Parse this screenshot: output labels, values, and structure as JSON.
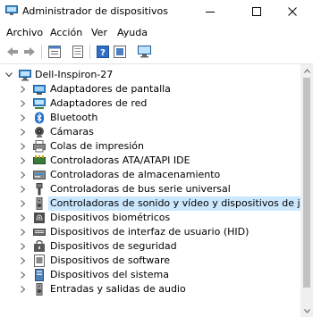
{
  "window": {
    "title": "Administrador de dispositivos"
  },
  "menu": [
    "Archivo",
    "Acción",
    "Ver",
    "Ayuda"
  ],
  "toolbar": [
    "back-arrow-icon",
    "forward-arrow-icon",
    "properties-icon",
    "show-hidden-icon",
    "help-icon",
    "update-driver-icon",
    "scan-hardware-icon"
  ],
  "tree": {
    "root": "Dell-Inspiron-27",
    "items": [
      {
        "label": "Adaptadores de pantalla",
        "icon": "display-adapter-icon"
      },
      {
        "label": "Adaptadores de red",
        "icon": "network-adapter-icon"
      },
      {
        "label": "Bluetooth",
        "icon": "bluetooth-icon"
      },
      {
        "label": "Cámaras",
        "icon": "camera-icon"
      },
      {
        "label": "Colas de impresión",
        "icon": "printer-icon"
      },
      {
        "label": "Controladoras ATA/ATAPI IDE",
        "icon": "ide-controller-icon"
      },
      {
        "label": "Controladoras de almacenamiento",
        "icon": "storage-controller-icon"
      },
      {
        "label": "Controladoras de bus serie universal",
        "icon": "usb-icon"
      },
      {
        "label": "Controladoras de sonido y vídeo y dispositivos de juego",
        "icon": "speaker-icon",
        "selected": true
      },
      {
        "label": "Dispositivos biométricos",
        "icon": "biometric-icon"
      },
      {
        "label": "Dispositivos de interfaz de usuario (HID)",
        "icon": "hid-icon"
      },
      {
        "label": "Dispositivos de seguridad",
        "icon": "security-device-icon"
      },
      {
        "label": "Dispositivos de software",
        "icon": "software-device-icon"
      },
      {
        "label": "Dispositivos del sistema",
        "icon": "system-device-icon"
      },
      {
        "label": "Entradas y salidas de audio",
        "icon": "audio-io-icon"
      }
    ]
  },
  "colors": {
    "selection": "#cce8ff",
    "accent": "#0078d7"
  }
}
